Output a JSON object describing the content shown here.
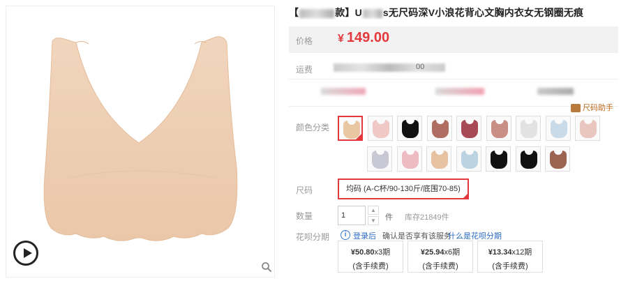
{
  "product": {
    "title_prefix": "【",
    "title_bracket_end": "款】U",
    "title_suffix": "s无尺码深V小浪花背心文胸内衣女无钢圈无痕",
    "image_alt": "product-bra-image"
  },
  "price": {
    "label": "价格",
    "currency": "¥",
    "value": "149.00"
  },
  "shipping": {
    "label": "运费",
    "suffix": "00"
  },
  "size_helper": {
    "label": "尺码助手"
  },
  "colors": {
    "label": "颜色分类",
    "swatches": [
      "#e9c7a3",
      "#f0c9c6",
      "#111111",
      "#b06e62",
      "#a84a55",
      "#c98e85",
      "#e2e2e2",
      "#c9dbe8",
      "#eac6c1",
      "#c9c9d6",
      "#ecbcc2",
      "#e6c1a2",
      "#bcd3e2",
      "#111111",
      "#111111",
      "#9b6350"
    ]
  },
  "size": {
    "label": "尺码",
    "option": "均码 (A-C杯/90-130斤/底围70-85)"
  },
  "quantity": {
    "label": "数量",
    "value": "1",
    "unit": "件",
    "stock": "库存21849件"
  },
  "installment": {
    "label": "花呗分期",
    "login_link": "登录后",
    "login_rest": "确认是否享有该服务",
    "what_link": "什么是花呗分期",
    "plans": [
      {
        "amount": "¥50.80",
        "periods": "x3期",
        "fee": "(含手续费)"
      },
      {
        "amount": "¥25.94",
        "periods": "x6期",
        "fee": "(含手续费)"
      },
      {
        "amount": "¥13.34",
        "periods": "x12期",
        "fee": "(含手续费)"
      }
    ]
  }
}
